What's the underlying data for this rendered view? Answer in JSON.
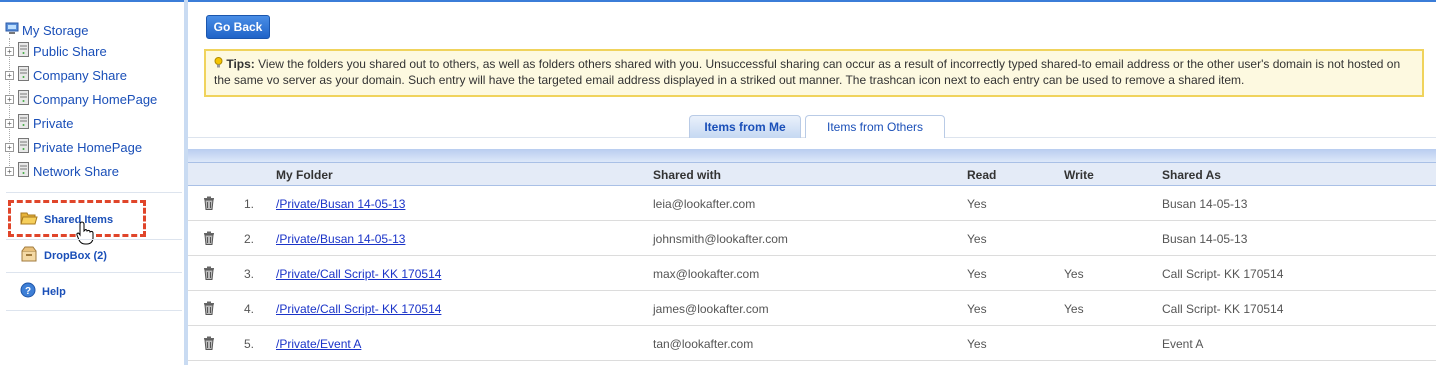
{
  "sidebar": {
    "root_label": "My Storage",
    "tree": [
      {
        "label": "Public Share"
      },
      {
        "label": "Company Share"
      },
      {
        "label": "Company HomePage"
      },
      {
        "label": "Private"
      },
      {
        "label": "Private HomePage"
      },
      {
        "label": "Network Share"
      }
    ],
    "shared_items_label": "Shared Items",
    "dropbox_label": "DropBox (2)",
    "help_label": "Help"
  },
  "main": {
    "go_back_label": "Go Back",
    "tips_title": "Tips:",
    "tips_text": " View the folders you shared out to others, as well as folders others shared with you. Unsuccessful sharing can occur as a result of incorrectly typed shared-to email address or the other user's domain is not hosted on the same vo server as your domain. Such entry will have the targeted email address displayed in a striked out manner. The trashcan icon next to each entry can be used to remove a shared item.",
    "tabs": [
      {
        "label": "Items from Me",
        "active": true
      },
      {
        "label": "Items from Others",
        "active": false
      }
    ],
    "columns": {
      "folder": "My Folder",
      "shared_with": "Shared with",
      "read": "Read",
      "write": "Write",
      "shared_as": "Shared As"
    },
    "rows": [
      {
        "num": "1.",
        "folder": "/Private/Busan 14-05-13",
        "shared_with": "leia@lookafter.com",
        "read": "Yes",
        "write": "",
        "shared_as": "Busan 14-05-13"
      },
      {
        "num": "2.",
        "folder": "/Private/Busan 14-05-13",
        "shared_with": "johnsmith@lookafter.com",
        "read": "Yes",
        "write": "",
        "shared_as": "Busan 14-05-13"
      },
      {
        "num": "3.",
        "folder": "/Private/Call Script- KK 170514",
        "shared_with": "max@lookafter.com",
        "read": "Yes",
        "write": "Yes",
        "shared_as": "Call Script- KK 170514"
      },
      {
        "num": "4.",
        "folder": "/Private/Call Script- KK 170514",
        "shared_with": "james@lookafter.com",
        "read": "Yes",
        "write": "Yes",
        "shared_as": "Call Script- KK 170514"
      },
      {
        "num": "5.",
        "folder": "/Private/Event A",
        "shared_with": "tan@lookafter.com",
        "read": "Yes",
        "write": "",
        "shared_as": "Event A"
      }
    ]
  }
}
